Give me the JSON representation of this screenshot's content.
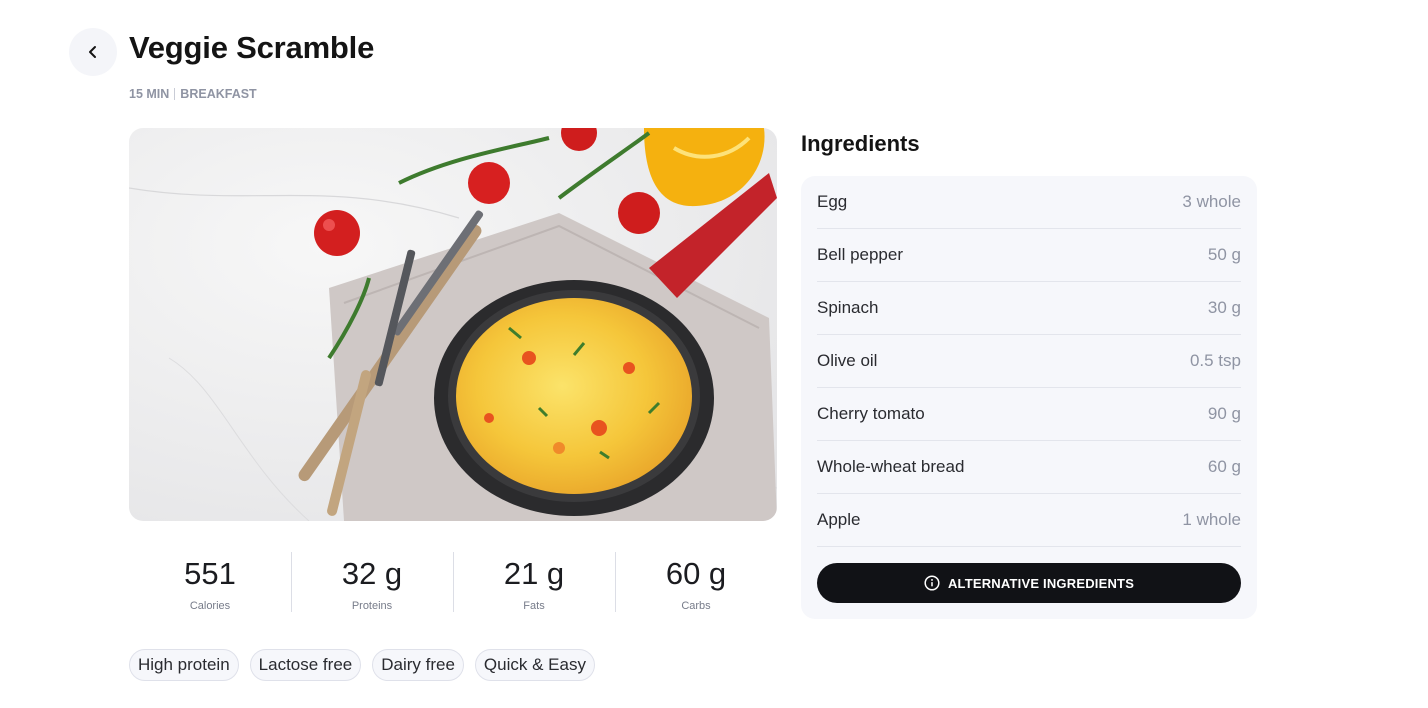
{
  "recipe": {
    "title": "Veggie Scramble",
    "duration": "15 MIN",
    "category": "BREAKFAST"
  },
  "macros": [
    {
      "value": "551",
      "label": "Calories"
    },
    {
      "value": "32 g",
      "label": "Proteins"
    },
    {
      "value": "21 g",
      "label": "Fats"
    },
    {
      "value": "60 g",
      "label": "Carbs"
    }
  ],
  "tags": [
    "High protein",
    "Lactose free",
    "Dairy free",
    "Quick & Easy"
  ],
  "ingredients": {
    "title": "Ingredients",
    "items": [
      {
        "name": "Egg",
        "qty": "3 whole"
      },
      {
        "name": "Bell pepper",
        "qty": "50 g"
      },
      {
        "name": "Spinach",
        "qty": "30 g"
      },
      {
        "name": "Olive oil",
        "qty": "0.5 tsp"
      },
      {
        "name": "Cherry tomato",
        "qty": "90 g"
      },
      {
        "name": "Whole-wheat bread",
        "qty": "60 g"
      },
      {
        "name": "Apple",
        "qty": "1 whole"
      }
    ],
    "alt_button": "ALTERNATIVE INGREDIENTS"
  },
  "icons": {
    "back": "chevron-left-icon",
    "alt": "info-circle-icon"
  },
  "colors": {
    "button_bg": "#111216",
    "card_bg": "#f6f7fb",
    "muted_text": "#8f94a3"
  }
}
